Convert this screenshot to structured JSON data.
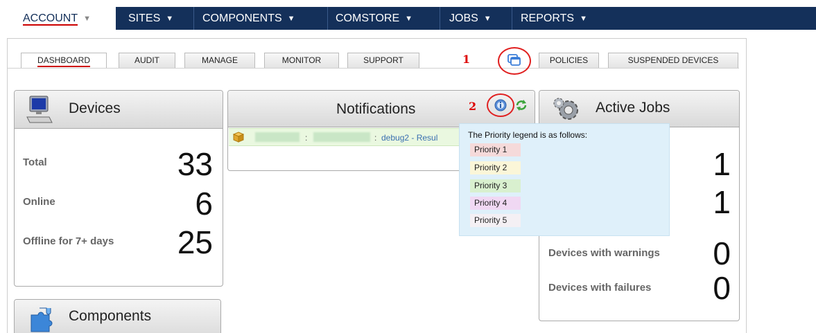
{
  "nav": {
    "items": [
      {
        "label": "ACCOUNT"
      },
      {
        "label": "SITES"
      },
      {
        "label": "COMPONENTS"
      },
      {
        "label": "COMSTORE"
      },
      {
        "label": "JOBS"
      },
      {
        "label": "REPORTS"
      }
    ],
    "caret": "▼"
  },
  "tabs": [
    {
      "label": "DASHBOARD"
    },
    {
      "label": "AUDIT"
    },
    {
      "label": "MANAGE"
    },
    {
      "label": "MONITOR"
    },
    {
      "label": "SUPPORT"
    },
    {
      "label": "POLICIES"
    },
    {
      "label": "SUSPENDED DEVICES"
    }
  ],
  "callouts": {
    "one": "1",
    "two": "2"
  },
  "devices": {
    "title": "Devices",
    "total_label": "Total",
    "total": "33",
    "online_label": "Online",
    "online": "6",
    "offline_label": "Offline for 7+ days",
    "offline": "25"
  },
  "components": {
    "title": "Components"
  },
  "notifications": {
    "title": "Notifications",
    "row_sep1": ":",
    "row_sep2": ":",
    "row_text": "debug2 - Resul"
  },
  "jobs": {
    "title": "Active Jobs",
    "val1": "1",
    "val2": "1",
    "warnings_label": "Devices with warnings",
    "warnings": "0",
    "failures_label": "Devices with failures",
    "failures": "0"
  },
  "legend": {
    "title": "The Priority legend is as follows:",
    "priorities": [
      {
        "label": "Priority 1",
        "color": "#f5dada"
      },
      {
        "label": "Priority 2",
        "color": "#fbf6d8"
      },
      {
        "label": "Priority 3",
        "color": "#d9f0cf"
      },
      {
        "label": "Priority 4",
        "color": "#f0d8f3"
      },
      {
        "label": "Priority 5",
        "color": "#f4f0f4"
      }
    ]
  },
  "colors": {
    "nav_bg": "#14305a",
    "accent": "#cc0000"
  }
}
